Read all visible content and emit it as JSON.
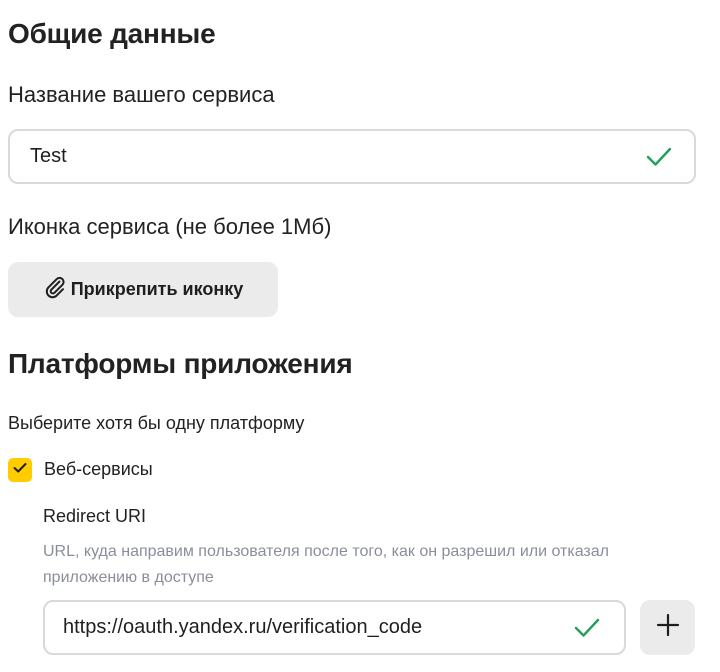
{
  "general": {
    "title": "Общие данные",
    "service_name_label": "Название вашего сервиса",
    "service_name_value": "Test",
    "service_icon_label": "Иконка сервиса (не более 1Мб)",
    "attach_icon_button": "Прикрепить иконку"
  },
  "platforms": {
    "title": "Платформы приложения",
    "hint": "Выберите хотя бы одну платформу",
    "web": {
      "label": "Веб-сервисы",
      "checked": true,
      "redirect_label": "Redirect URI",
      "redirect_description": "URL, куда направим пользователя после того, как он разрешил или отказал приложению в доступе",
      "redirect_value": "https://oauth.yandex.ru/verification_code"
    }
  },
  "colors": {
    "accent_yellow": "#ffcc00",
    "valid_green": "#22a05a",
    "button_gray": "#ebebeb",
    "border_gray": "#d9d9d9"
  },
  "icons": [
    "check-icon",
    "paperclip-icon",
    "plus-icon"
  ]
}
